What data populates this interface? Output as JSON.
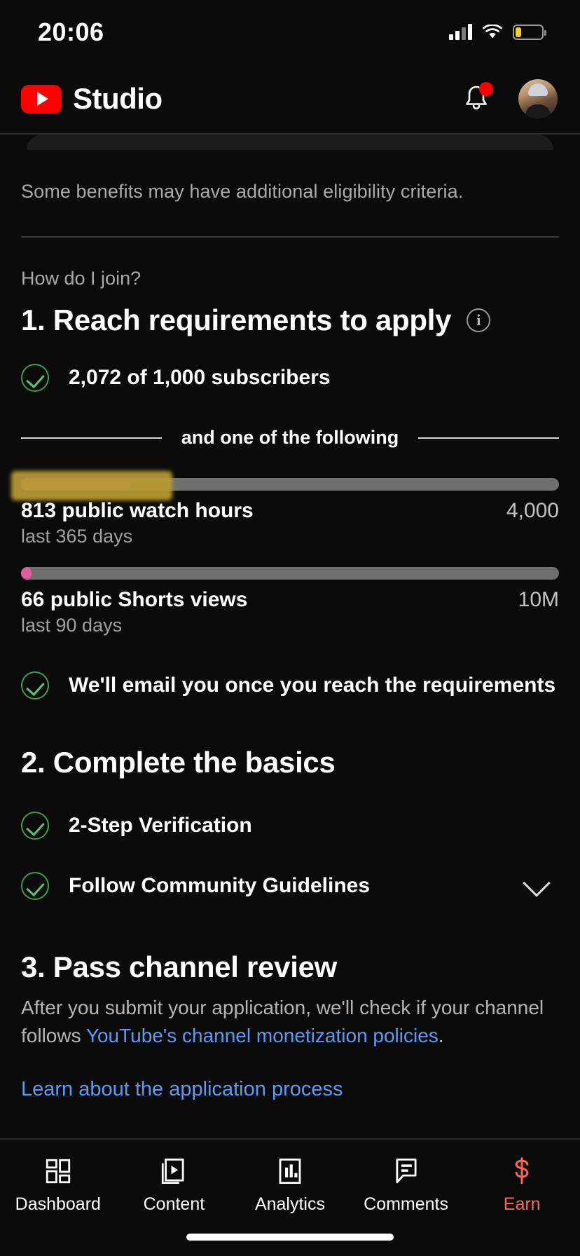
{
  "status_bar": {
    "time": "20:06",
    "signal_icon": "cellular-signal-icon",
    "wifi_icon": "wifi-icon",
    "battery_icon": "battery-low-icon",
    "battery_color": "#f5d020"
  },
  "app_header": {
    "logo_icon": "youtube-play-logo",
    "title": "Studio",
    "notifications_icon": "bell-icon",
    "notifications_has_badge": true,
    "badge_color": "#ff0000",
    "avatar_icon": "account-avatar"
  },
  "main": {
    "benefits_note": "Some benefits may have additional eligibility criteria.",
    "how_do_i_join_label": "How do I join?",
    "step1": {
      "title": "1. Reach requirements to apply",
      "info_icon": "info-icon",
      "subscriber_requirement": {
        "status_icon": "check-circle-icon",
        "text": "2,072 of 1,000 subscribers",
        "met": true
      },
      "divider_label": "and one of the following",
      "metrics": [
        {
          "name": "813 public watch hours",
          "period": "last 365 days",
          "goal": "4,000",
          "progress_percent": 20.3,
          "fill_color": "#e05c9e",
          "track_color": "#6f6f6f"
        },
        {
          "name": "66 public Shorts views",
          "period": "last 90 days",
          "goal": "10M",
          "progress_percent": 2,
          "fill_color": "#e05c9e",
          "track_color": "#6f6f6f"
        }
      ],
      "email_notice": {
        "status_icon": "check-circle-icon",
        "text": "We'll email you once you reach the requirements",
        "met": true
      },
      "redaction": {
        "type": "highlighter-mark",
        "color": "#b99b33"
      }
    },
    "step2": {
      "title": "2. Complete the basics",
      "items": [
        {
          "status_icon": "check-circle-icon",
          "label": "2-Step Verification",
          "met": true,
          "expandable": false
        },
        {
          "status_icon": "check-circle-icon",
          "label": "Follow Community Guidelines",
          "met": true,
          "expandable": true,
          "expand_icon": "chevron-down-icon"
        }
      ]
    },
    "step3": {
      "title": "3. Pass channel review",
      "description_before_link": "After you submit your application, we'll check if your channel follows ",
      "description_link": "YouTube's channel monetization policies",
      "description_after_link": ".",
      "learn_link": "Learn about the application process",
      "link_color": "#5b9bf3"
    }
  },
  "tab_bar": {
    "active_tab": "Earn",
    "active_color": "#ff6352",
    "tabs": [
      {
        "label": "Dashboard",
        "icon": "dashboard-grid-icon"
      },
      {
        "label": "Content",
        "icon": "video-play-icon"
      },
      {
        "label": "Analytics",
        "icon": "bar-chart-icon"
      },
      {
        "label": "Comments",
        "icon": "comment-bubble-icon"
      },
      {
        "label": "Earn",
        "icon": "dollar-sign-icon"
      }
    ]
  },
  "home_indicator": "home-indicator-bar"
}
